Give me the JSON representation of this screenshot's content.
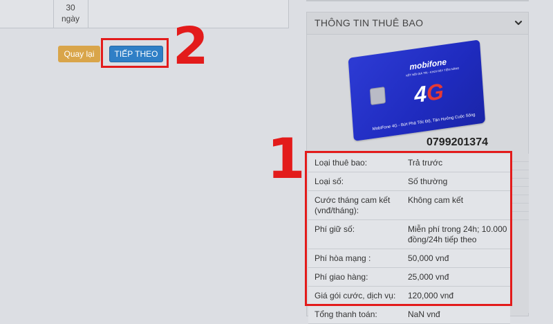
{
  "plan": {
    "duration_value": "30",
    "duration_unit": "ngày"
  },
  "actions": {
    "back_label": "Quay lại",
    "next_label": "TIẾP THEO"
  },
  "annotations": {
    "step_next": "2",
    "step_info": "1"
  },
  "panel": {
    "title": "THÔNG TIN THUÊ BAO",
    "chevron_icon": "chevron-down-icon"
  },
  "sim": {
    "brand": "mobifone",
    "tagline": "KẾT NỐI GIÁ TRỊ - KHƠI DẬY TIỀM NĂNG",
    "network": "4",
    "network_g": "G",
    "bottom_text": "MobiFone 4G - Bứt Phá Tốc Độ, Tận Hưởng Cuộc Sống",
    "phone": "0799201374"
  },
  "subscription_info": [
    {
      "label": "Loại thuê bao:",
      "value": "Trả trước"
    },
    {
      "label": "Loại số:",
      "value": "Số thường"
    },
    {
      "label": "Cước tháng cam kết (vnđ/tháng):",
      "value": "Không cam kết"
    },
    {
      "label": "Phí giữ số:",
      "value": "Miễn phí trong 24h; 10.000 đồng/24h tiếp theo"
    },
    {
      "label": "Phí hòa mạng :",
      "value": "50,000 vnđ"
    },
    {
      "label": "Phí giao hàng:",
      "value": "25,000 vnđ"
    },
    {
      "label": "Giá gói cước, dịch vụ:",
      "value": "120,000 vnđ"
    },
    {
      "label": "Tổng thanh toán:",
      "value": "NaN vnđ"
    }
  ],
  "colors": {
    "highlight": "#e31b1b",
    "back_button": "#d9a54a",
    "next_button": "#2f7fc6",
    "sim_card": "#2d3bd4"
  }
}
